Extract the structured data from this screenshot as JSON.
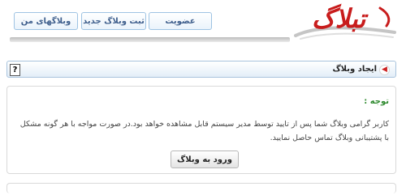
{
  "header": {
    "logo_text": "تبلاگ",
    "nav": {
      "my_weblogs": "وبلاگهای من",
      "register_weblog": "ثبت وبلاگ جدید",
      "membership": "عضویت"
    }
  },
  "section": {
    "title": "ایجاد وبلاگ",
    "help": "?"
  },
  "notice": {
    "title": "توجه :",
    "text": "کاربر گرامی وبلاگ شما پس از تایید توسط مدیر سیستم قابل مشاهده خواهد بود.در صورت مواجه با هر گونه مشکل با پشتیبانی وبلاگ تماس حاصل نمایید.",
    "enter_button": "ورود به وبلاگ"
  },
  "colors": {
    "brand_red": "#c81c1c",
    "nav_blue": "#3f5f8d",
    "notice_green": "#2f8a2f"
  }
}
